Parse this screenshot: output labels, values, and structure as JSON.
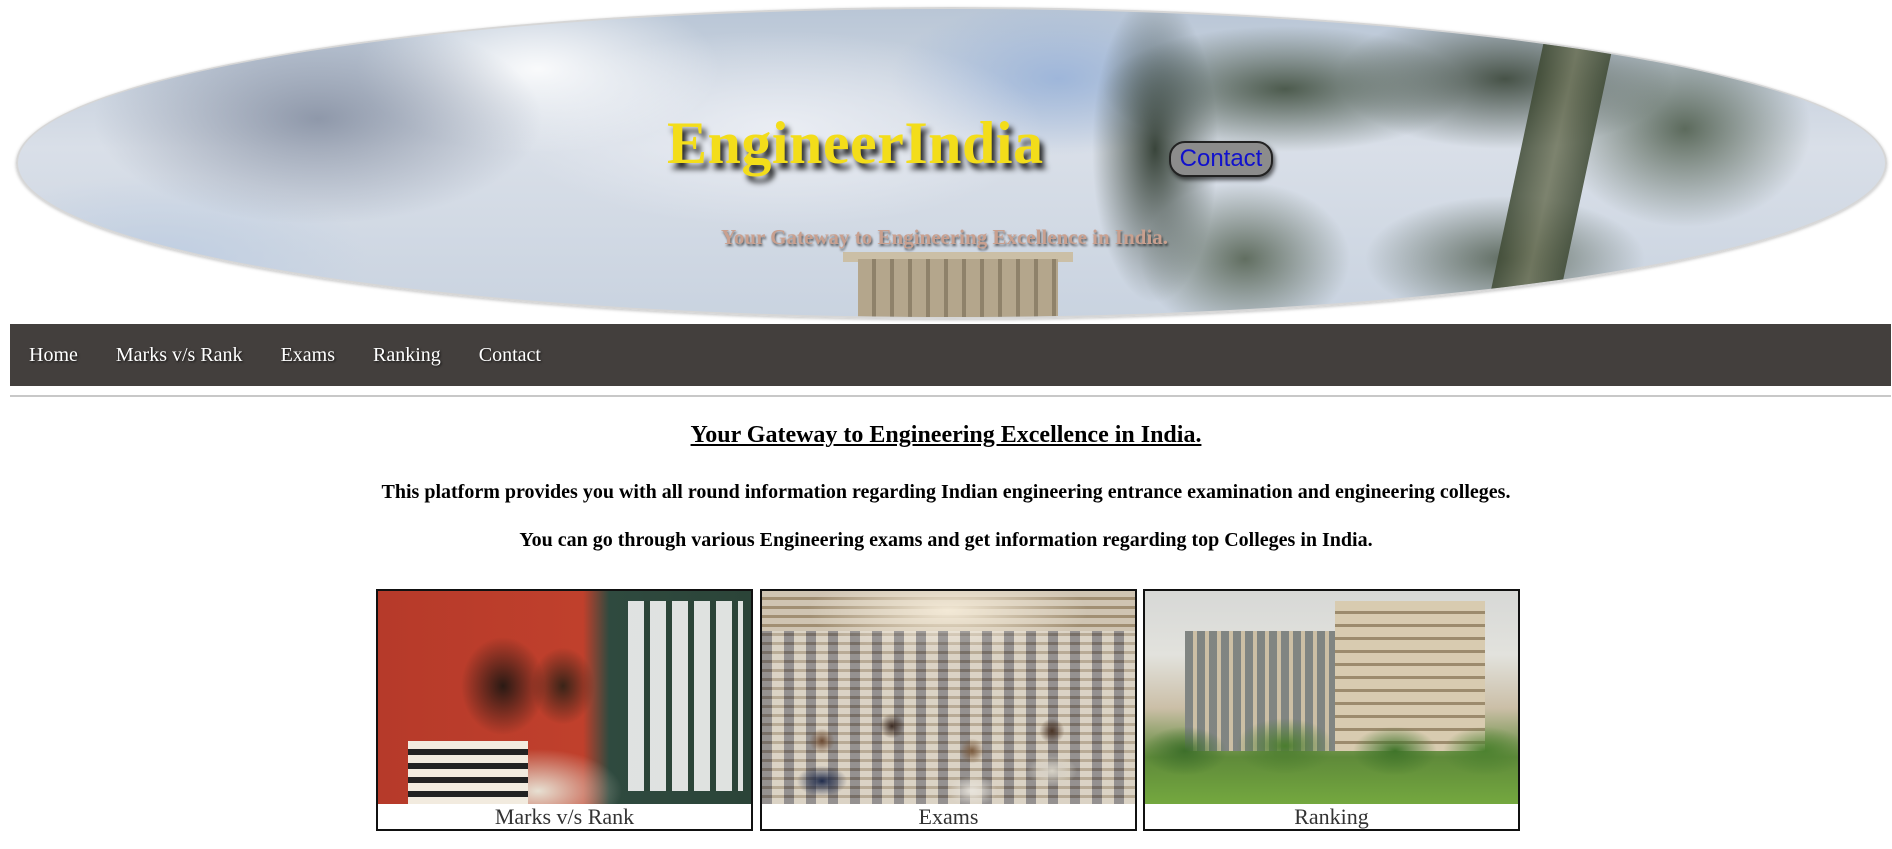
{
  "banner": {
    "brand": "EngineerIndia",
    "contact_button": "Contact",
    "tagline": "Your Gateway to Engineering Excellence in India."
  },
  "nav": {
    "items": [
      {
        "label": "Home"
      },
      {
        "label": "Marks v/s Rank"
      },
      {
        "label": "Exams"
      },
      {
        "label": "Ranking"
      },
      {
        "label": "Contact"
      }
    ]
  },
  "main": {
    "heading": "Your Gateway to Engineering Excellence in India.",
    "paragraph1": "This platform provides you with all round information regarding Indian engineering entrance examination and engineering colleges.",
    "paragraph2": "You can go through various Engineering exams and get information regarding top Colleges in India."
  },
  "cards": [
    {
      "caption": "Marks v/s Rank",
      "image": "students-checking-results-photo"
    },
    {
      "caption": "Exams",
      "image": "exam-hall-photo"
    },
    {
      "caption": "Ranking",
      "image": "college-campus-photo"
    }
  ],
  "colors": {
    "brand_title": "#f3dd1a",
    "navbar_bg": "#433f3d",
    "contact_link": "#1111cc",
    "tagline": "#c9a08f"
  }
}
